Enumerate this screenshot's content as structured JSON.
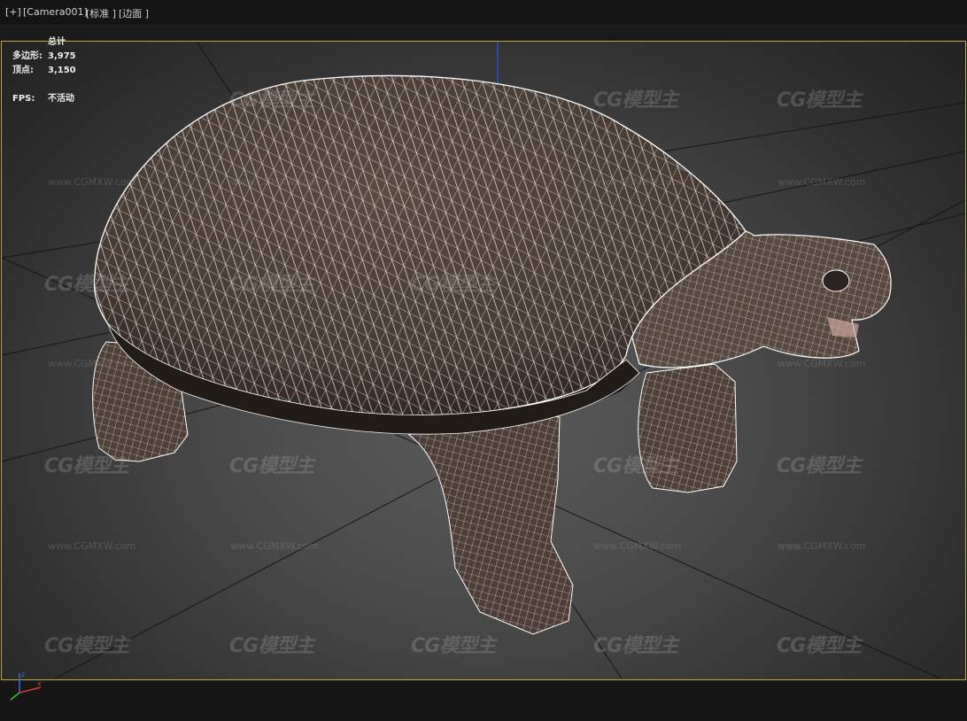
{
  "viewport_menu": {
    "plus": "[+]",
    "camera": "[Camera001]",
    "shading": "[标准 ]",
    "display": "[边面 ]"
  },
  "stats": {
    "header": "总计",
    "polygons_label": "多边形:",
    "polygons_value": "3,975",
    "vertices_label": "顶点:",
    "vertices_value": "3,150",
    "fps_label": "FPS:",
    "fps_value": "不活动"
  },
  "watermark": {
    "logo": "CG模型主",
    "url": "www.CGMXW.com"
  },
  "colors": {
    "viewport_border": "#b8ad3a",
    "shell": "#4e4138",
    "skin": "#584a40",
    "wire": "#ffffff",
    "axis_x": "#d83a3a",
    "axis_y": "#36c03a",
    "axis_z": "#3a6bd8"
  },
  "icons": [
    "axis-gizmo-icon"
  ]
}
